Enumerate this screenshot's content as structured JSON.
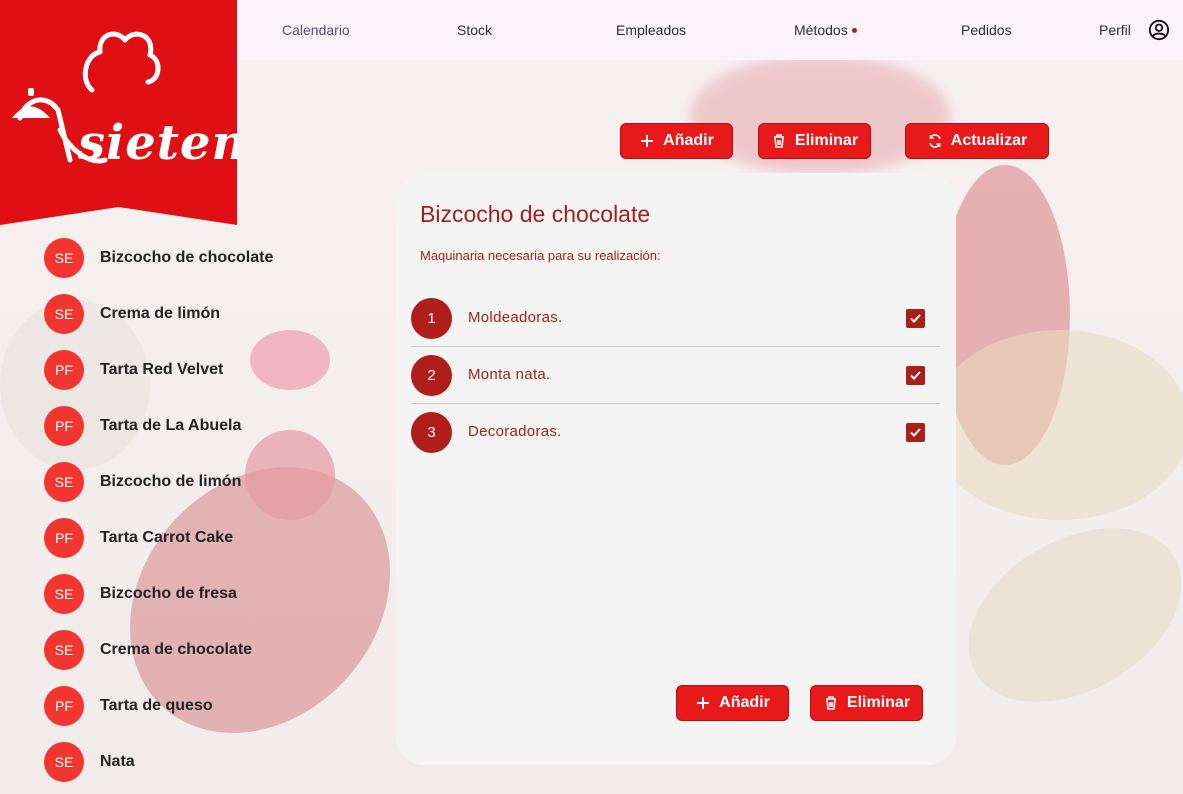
{
  "brand": {
    "logo_text": "sietem",
    "color": "#e00f14"
  },
  "nav": {
    "items": [
      {
        "label": "Calendario",
        "active": true
      },
      {
        "label": "Stock"
      },
      {
        "label": "Empleados"
      },
      {
        "label": "Métodos",
        "badge_dot": true
      },
      {
        "label": "Pedidos"
      },
      {
        "label": "Perfil"
      }
    ],
    "profile_icon": "account-circle-icon"
  },
  "sidebar": {
    "items": [
      {
        "badge": "SE",
        "label": "Bizcocho de chocolate"
      },
      {
        "badge": "SE",
        "label": "Crema de limón"
      },
      {
        "badge": "PF",
        "label": "Tarta Red Velvet"
      },
      {
        "badge": "PF",
        "label": "Tarta de La Abuela"
      },
      {
        "badge": "SE",
        "label": "Bizcocho de limón"
      },
      {
        "badge": "PF",
        "label": "Tarta Carrot Cake"
      },
      {
        "badge": "SE",
        "label": "Bizcocho de fresa"
      },
      {
        "badge": "SE",
        "label": "Crema de chocolate"
      },
      {
        "badge": "PF",
        "label": "Tarta de queso"
      },
      {
        "badge": "SE",
        "label": "Nata"
      }
    ]
  },
  "toolbar": {
    "add_label": "Añadir",
    "delete_label": "Eliminar",
    "refresh_label": "Actualizar"
  },
  "detail": {
    "title": "Bizcocho de chocolate",
    "subtitle": "Maquinaria necesaria para su realización:",
    "machines": [
      {
        "num": "1",
        "label": "Moldeadoras.",
        "checked": true
      },
      {
        "num": "2",
        "label": "Monta nata.",
        "checked": true
      },
      {
        "num": "3",
        "label": "Decoradoras.",
        "checked": true
      }
    ],
    "add_label": "Añadir",
    "delete_label": "Eliminar"
  },
  "colors": {
    "accent": "#e8191a",
    "dark_red": "#a3201d",
    "badge": "#f2352f"
  }
}
